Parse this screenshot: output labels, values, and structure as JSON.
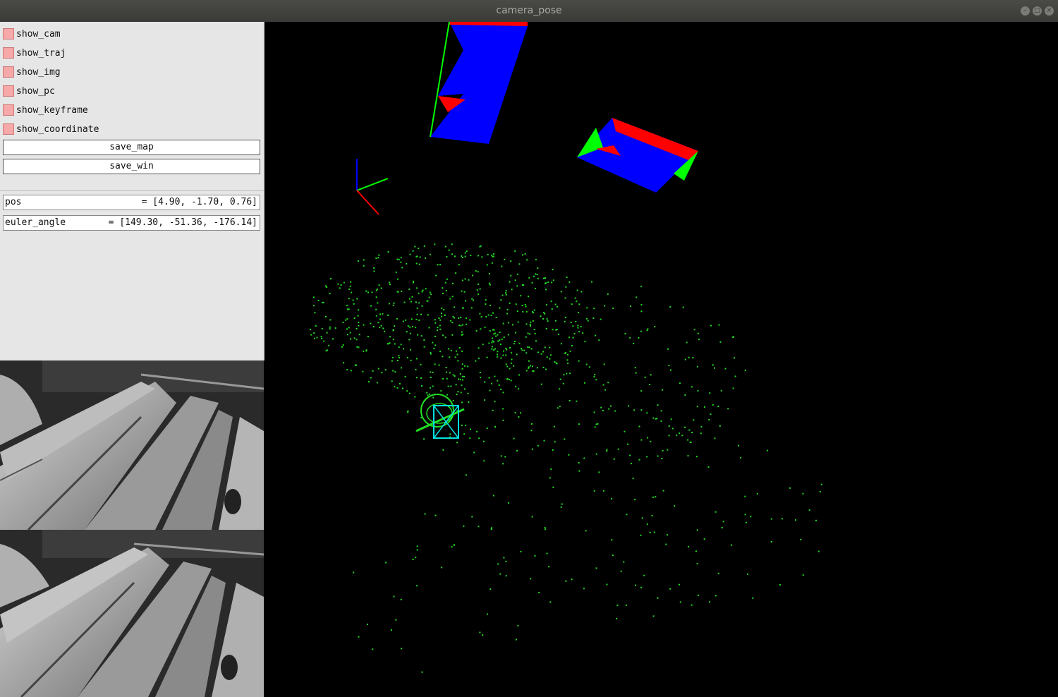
{
  "window": {
    "title": "camera_pose"
  },
  "panel": {
    "checkboxes": [
      {
        "label": "show_cam",
        "checked": false
      },
      {
        "label": "show_traj",
        "checked": false
      },
      {
        "label": "show_img",
        "checked": false
      },
      {
        "label": "show_pc",
        "checked": false
      },
      {
        "label": "show_keyframe",
        "checked": false
      },
      {
        "label": "show_coordinate",
        "checked": false
      }
    ],
    "buttons": {
      "save_map": "save_map",
      "save_win": "save_win"
    },
    "vars": {
      "pos": {
        "name": "pos",
        "value": "= [4.90, -1.70, 0.76]"
      },
      "euler_angle": {
        "name": "euler_angle",
        "value": "= [149.30, -51.36, -176.14]"
      }
    }
  },
  "colors": {
    "point_cloud": "#22dd22",
    "axis_x": "#ff0000",
    "axis_y": "#00ff00",
    "axis_z": "#0000ff",
    "keyframe_face": "#0000ff",
    "current_camera": "#00e0e0"
  }
}
